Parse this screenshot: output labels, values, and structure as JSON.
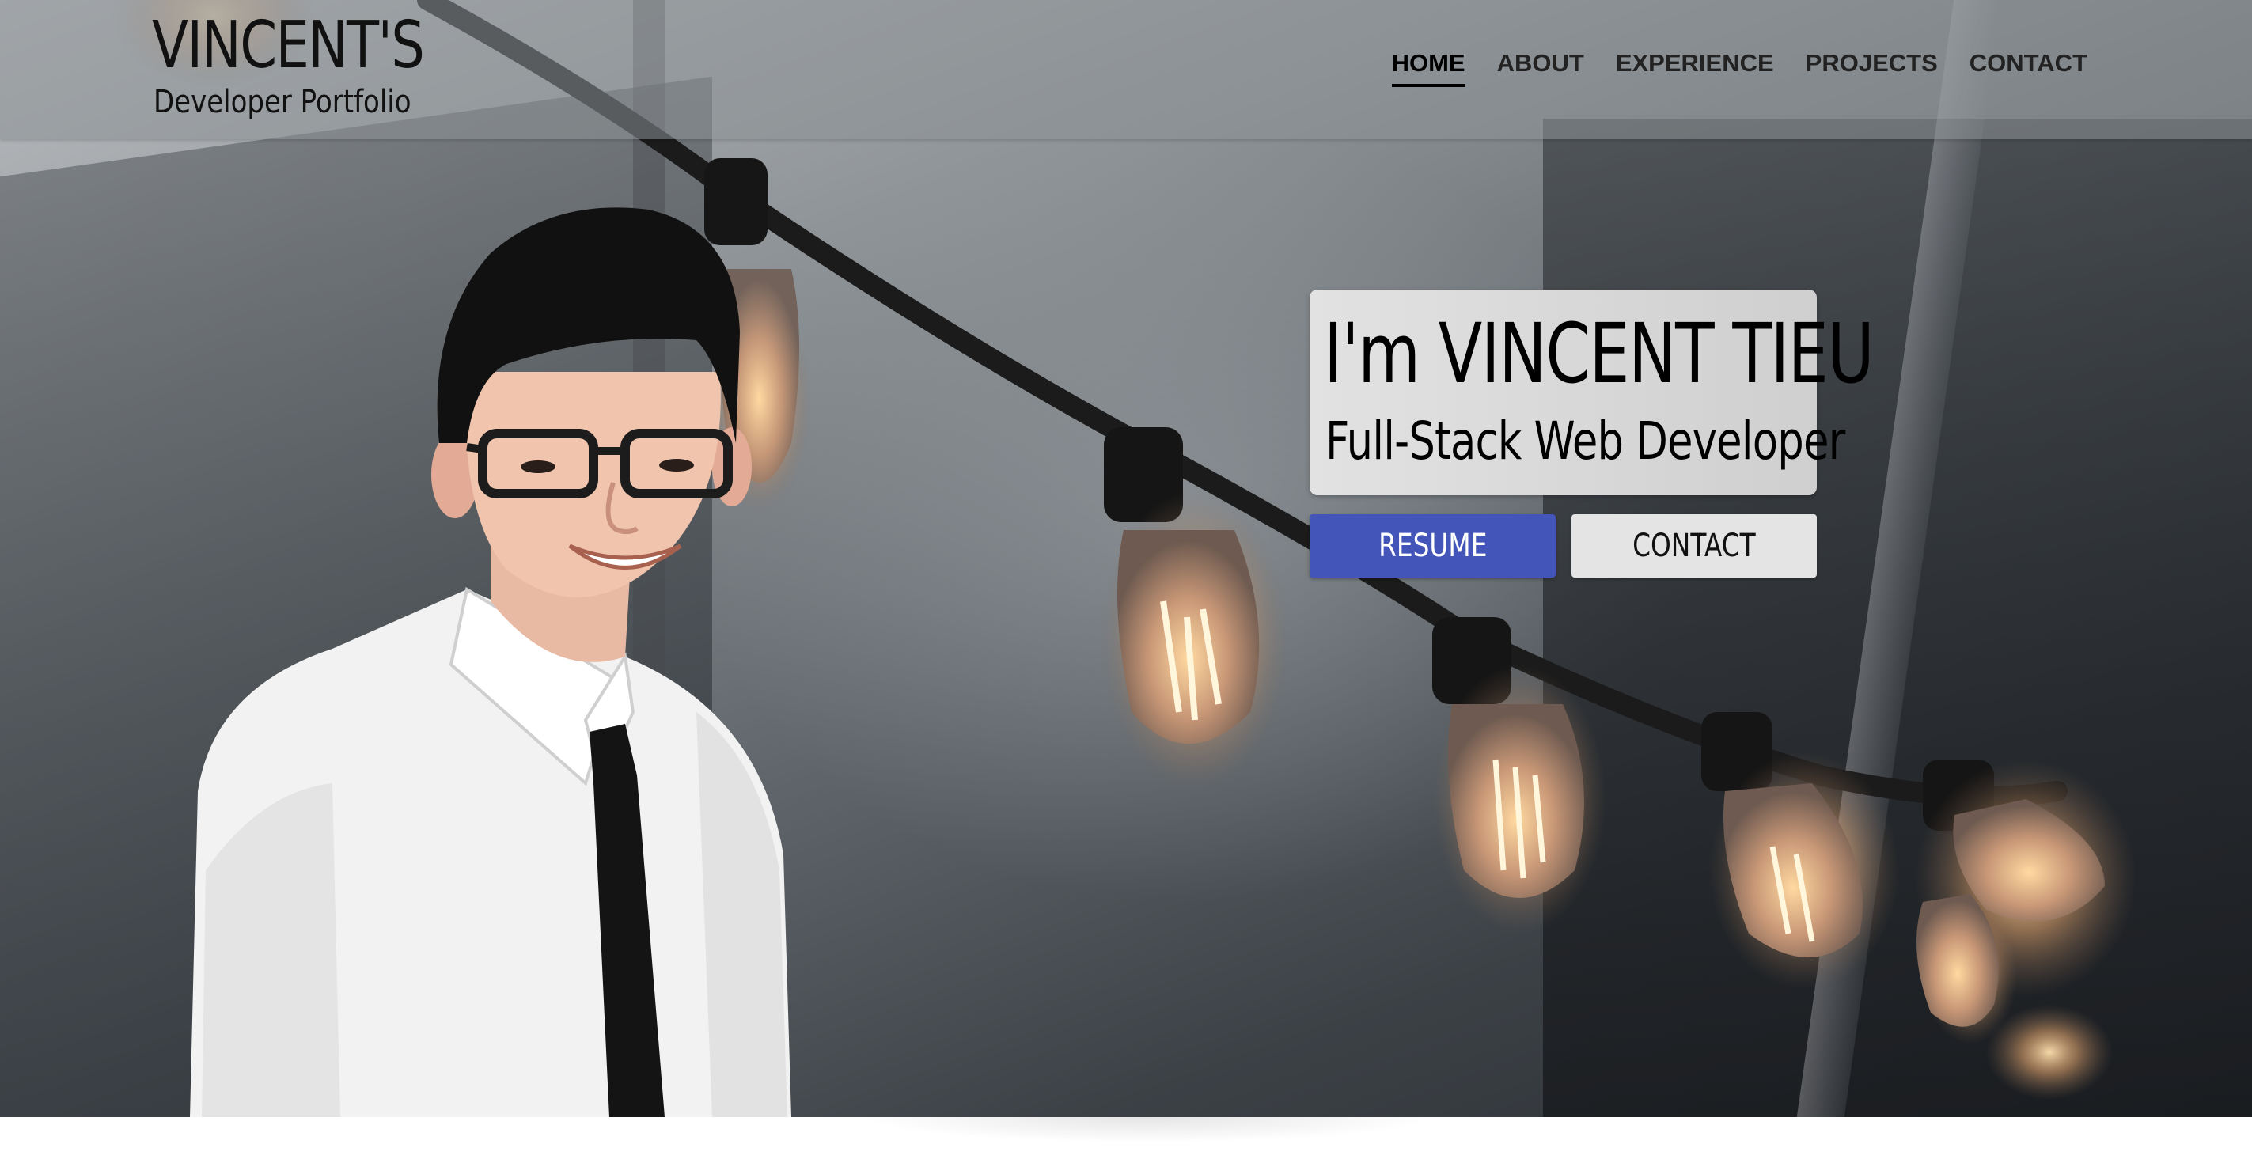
{
  "brand": {
    "title": "VINCENT'S",
    "subtitle": "Developer Portfolio"
  },
  "nav": {
    "items": [
      {
        "label": "HOME",
        "active": true
      },
      {
        "label": "ABOUT",
        "active": false
      },
      {
        "label": "EXPERIENCE",
        "active": false
      },
      {
        "label": "PROJECTS",
        "active": false
      },
      {
        "label": "CONTACT",
        "active": false
      }
    ]
  },
  "hero": {
    "name_line": "I'm VINCENT TIEU",
    "role_line": "Full-Stack Web Developer",
    "resume_button": "RESUME",
    "contact_button": "CONTACT"
  },
  "colors": {
    "accent": "#4355b9",
    "card_bg": "#dcdcdc",
    "secondary_button": "#e4e4e4"
  }
}
